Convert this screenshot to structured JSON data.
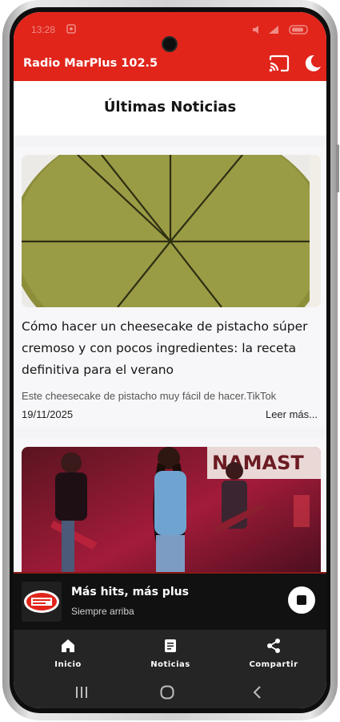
{
  "status_bar": {
    "time": "13:28"
  },
  "app_bar": {
    "title": "Radio MarPlus 102.5"
  },
  "page": {
    "title": "Últimas Noticias"
  },
  "articles": [
    {
      "title": "Cómo hacer un cheesecake de pistacho súper cremoso y con pocos ingredientes: la receta definitiva para el verano",
      "excerpt": "Este cheesecake de pistacho muy fácil de hacer.TikTok",
      "date": "19/11/2025",
      "more_label": "Leer más..."
    },
    {
      "image_sign_text": "NAMAST"
    }
  ],
  "player": {
    "logo_text": "RADIO MARPLUS",
    "title": "Más hits, más plus",
    "subtitle": "Siempre arriba"
  },
  "bottom_nav": {
    "items": [
      {
        "label": "Inicio",
        "icon": "home-icon"
      },
      {
        "label": "Noticias",
        "icon": "document-icon"
      },
      {
        "label": "Compartir",
        "icon": "share-icon"
      }
    ]
  },
  "colors": {
    "brand_red": "#e1251b",
    "nav_bg": "#252525",
    "player_bg": "#111111"
  }
}
